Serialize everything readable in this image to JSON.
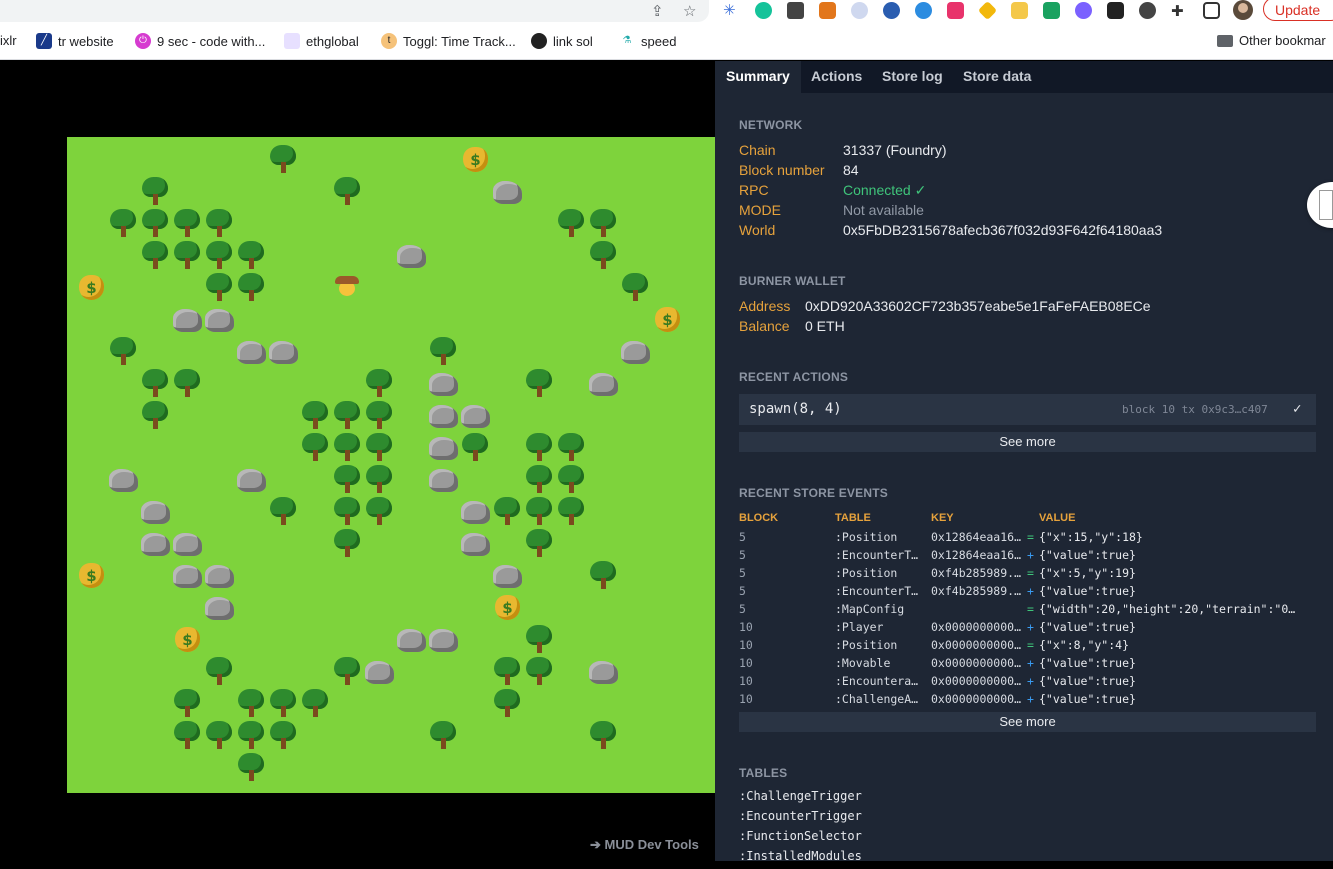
{
  "browser": {
    "update_label": "Update",
    "bookmarks": [
      {
        "label": "ixlr",
        "icon": "pixlr-icon"
      },
      {
        "label": "tr website",
        "icon": "tr-logo-icon"
      },
      {
        "label": "9 sec - code with...",
        "icon": "power-icon"
      },
      {
        "label": "ethglobal",
        "icon": "ethglobal-icon"
      },
      {
        "label": "Toggl: Time Track...",
        "icon": "toggl-icon"
      },
      {
        "label": "link sol",
        "icon": "github-icon"
      },
      {
        "label": "speed",
        "icon": "speed-icon"
      }
    ],
    "other_bookmarks_label": "Other bookmar"
  },
  "game": {
    "devtools_link": "➔ MUD Dev Tools",
    "grid": {
      "cols": 20,
      "rows": 20
    },
    "player": {
      "x": 8,
      "y": 4
    },
    "trees": [
      [
        6,
        0
      ],
      [
        8,
        1
      ],
      [
        2,
        1
      ],
      [
        1,
        2
      ],
      [
        2,
        2
      ],
      [
        3,
        2
      ],
      [
        4,
        2
      ],
      [
        15,
        2
      ],
      [
        16,
        2
      ],
      [
        2,
        3
      ],
      [
        3,
        3
      ],
      [
        4,
        3
      ],
      [
        5,
        3
      ],
      [
        16,
        3
      ],
      [
        4,
        4
      ],
      [
        5,
        4
      ],
      [
        17,
        4
      ],
      [
        1,
        6
      ],
      [
        11,
        6
      ],
      [
        2,
        7
      ],
      [
        3,
        7
      ],
      [
        9,
        7
      ],
      [
        14,
        7
      ],
      [
        2,
        8
      ],
      [
        7,
        8
      ],
      [
        8,
        8
      ],
      [
        9,
        8
      ],
      [
        7,
        9
      ],
      [
        8,
        9
      ],
      [
        9,
        9
      ],
      [
        12,
        9
      ],
      [
        14,
        9
      ],
      [
        15,
        9
      ],
      [
        8,
        10
      ],
      [
        9,
        10
      ],
      [
        14,
        10
      ],
      [
        15,
        10
      ],
      [
        6,
        11
      ],
      [
        8,
        11
      ],
      [
        9,
        11
      ],
      [
        13,
        11
      ],
      [
        14,
        11
      ],
      [
        15,
        11
      ],
      [
        8,
        12
      ],
      [
        14,
        12
      ],
      [
        16,
        13
      ],
      [
        14,
        15
      ],
      [
        4,
        16
      ],
      [
        8,
        16
      ],
      [
        13,
        16
      ],
      [
        14,
        16
      ],
      [
        3,
        17
      ],
      [
        5,
        17
      ],
      [
        6,
        17
      ],
      [
        7,
        17
      ],
      [
        13,
        17
      ],
      [
        3,
        18
      ],
      [
        4,
        18
      ],
      [
        5,
        18
      ],
      [
        6,
        18
      ],
      [
        11,
        18
      ],
      [
        16,
        18
      ],
      [
        5,
        19
      ]
    ],
    "rocks": [
      [
        13,
        1
      ],
      [
        10,
        3
      ],
      [
        3,
        5
      ],
      [
        4,
        5
      ],
      [
        5,
        6
      ],
      [
        6,
        6
      ],
      [
        17,
        6
      ],
      [
        11,
        7
      ],
      [
        16,
        7
      ],
      [
        11,
        8
      ],
      [
        12,
        8
      ],
      [
        11,
        9
      ],
      [
        1,
        10
      ],
      [
        5,
        10
      ],
      [
        11,
        10
      ],
      [
        2,
        11
      ],
      [
        12,
        11
      ],
      [
        2,
        12
      ],
      [
        3,
        12
      ],
      [
        12,
        12
      ],
      [
        3,
        13
      ],
      [
        4,
        13
      ],
      [
        13,
        13
      ],
      [
        4,
        14
      ],
      [
        10,
        15
      ],
      [
        11,
        15
      ],
      [
        9,
        16
      ],
      [
        16,
        16
      ]
    ],
    "bags": [
      [
        12,
        0
      ],
      [
        0,
        4
      ],
      [
        18,
        5
      ],
      [
        0,
        13
      ],
      [
        13,
        14
      ],
      [
        3,
        15
      ]
    ]
  },
  "devtools": {
    "tabs": [
      "Summary",
      "Actions",
      "Store log",
      "Store data"
    ],
    "network": {
      "title": "NETWORK",
      "rows": [
        {
          "key": "Chain",
          "value": "31337 (Foundry)"
        },
        {
          "key": "Block number",
          "value": "84"
        },
        {
          "key": "RPC",
          "value": "Connected ✓"
        },
        {
          "key": "MODE",
          "value": "Not available"
        },
        {
          "key": "World",
          "value": "0x5FbDB2315678afecb367f032d93F642f64180aa3"
        }
      ]
    },
    "burner_wallet": {
      "title": "BURNER WALLET",
      "address_label": "Address",
      "address": "0xDD920A33602CF723b357eabe5e1FaFeFAEB08ECe",
      "balance_label": "Balance",
      "balance": "0 ETH"
    },
    "recent_actions": {
      "title": "RECENT ACTIONS",
      "action": "spawn(8, 4)",
      "meta": "block 10 tx 0x9c3…c407",
      "status": "✓",
      "see_more": "See more"
    },
    "recent_store_events": {
      "title": "RECENT STORE EVENTS",
      "headers": [
        "BLOCK",
        "TABLE",
        "KEY",
        "VALUE"
      ],
      "rows": [
        {
          "block": "5",
          "table": ":Position",
          "key": "0x12864eaa16...",
          "op": "=",
          "value": "{\"x\":15,\"y\":18}"
        },
        {
          "block": "5",
          "table": ":EncounterTrigger",
          "key": "0x12864eaa16...",
          "op": "+",
          "value": "{\"value\":true}"
        },
        {
          "block": "5",
          "table": ":Position",
          "key": "0xf4b285989...",
          "op": "=",
          "value": "{\"x\":5,\"y\":19}"
        },
        {
          "block": "5",
          "table": ":EncounterTrigger",
          "key": "0xf4b285989...",
          "op": "+",
          "value": "{\"value\":true}"
        },
        {
          "block": "5",
          "table": ":MapConfig",
          "key": "",
          "op": "=",
          "value": "{\"width\":20,\"height\":20,\"terrain\":\"0…"
        },
        {
          "block": "10",
          "table": ":Player",
          "key": "0x0000000000...",
          "op": "+",
          "value": "{\"value\":true}"
        },
        {
          "block": "10",
          "table": ":Position",
          "key": "0x0000000000...",
          "op": "=",
          "value": "{\"x\":8,\"y\":4}"
        },
        {
          "block": "10",
          "table": ":Movable",
          "key": "0x0000000000...",
          "op": "+",
          "value": "{\"value\":true}"
        },
        {
          "block": "10",
          "table": ":Encounterable",
          "key": "0x0000000000...",
          "op": "+",
          "value": "{\"value\":true}"
        },
        {
          "block": "10",
          "table": ":ChallengeAccess",
          "key": "0x0000000000...",
          "op": "+",
          "value": "{\"value\":true}"
        }
      ],
      "see_more": "See more"
    },
    "tables": {
      "title": "TABLES",
      "items": [
        ":ChallengeTrigger",
        ":EncounterTrigger",
        ":FunctionSelector",
        ":InstalledModules"
      ]
    }
  }
}
